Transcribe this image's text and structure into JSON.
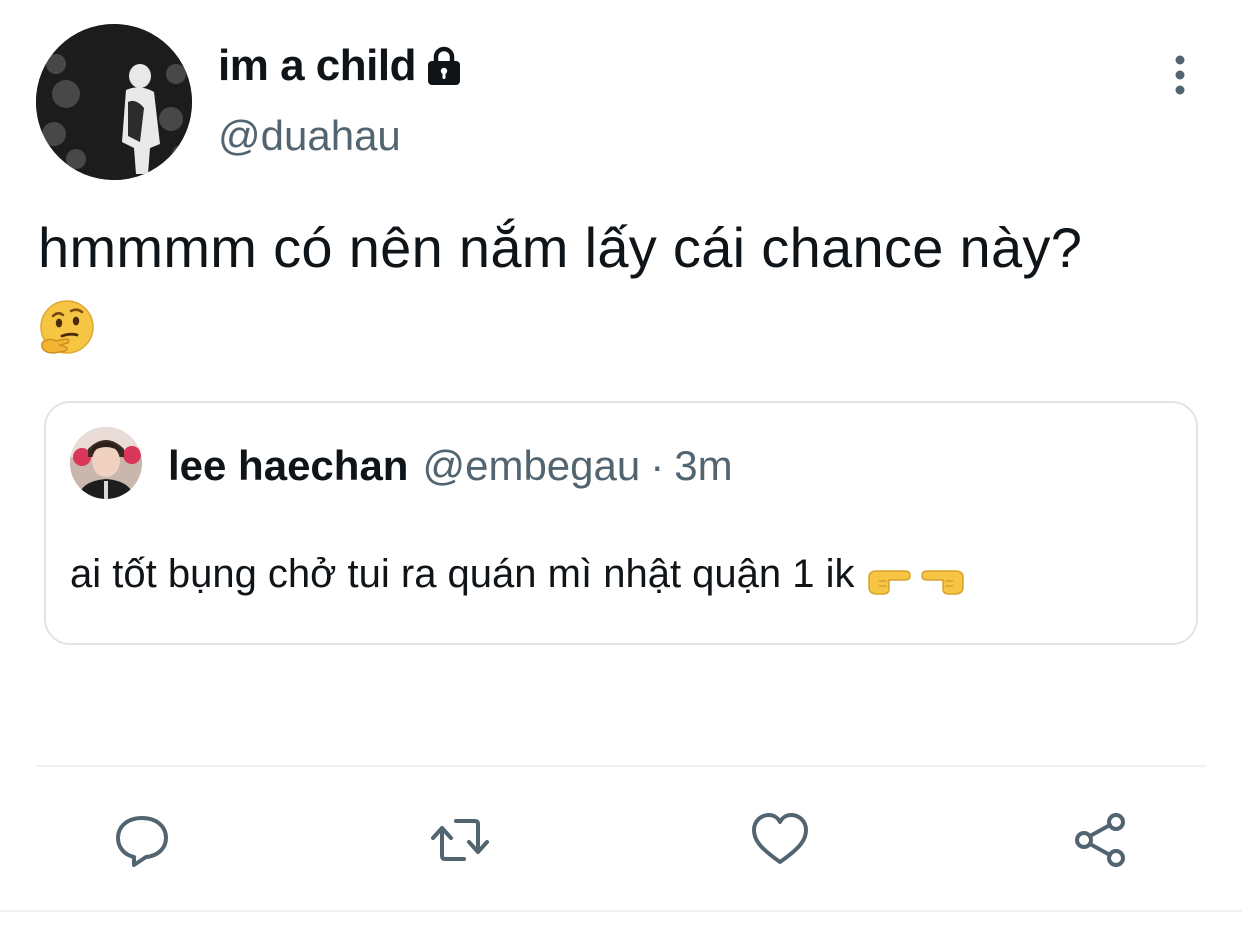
{
  "author": {
    "display_name": "im a child",
    "handle": "@duahau",
    "protected": true
  },
  "tweet": {
    "text": "hmmmm có nên nắm lấy cái chance này?",
    "emoji": "thinking-face"
  },
  "quoted_tweet": {
    "display_name": "lee haechan",
    "handle": "@embegau",
    "separator": "·",
    "time": "3m",
    "text": "ai tốt bụng chở tui ra quán mì nhật quận 1 ik",
    "emojis": [
      "backhand-index-pointing-right",
      "backhand-index-pointing-left"
    ]
  },
  "actions": [
    "reply-icon",
    "retweet-icon",
    "like-icon",
    "share-icon"
  ],
  "colors": {
    "text_primary": "#0f1419",
    "text_secondary": "#536471",
    "border": "#dfe4e8",
    "emoji_yellow": "#f6c543"
  }
}
